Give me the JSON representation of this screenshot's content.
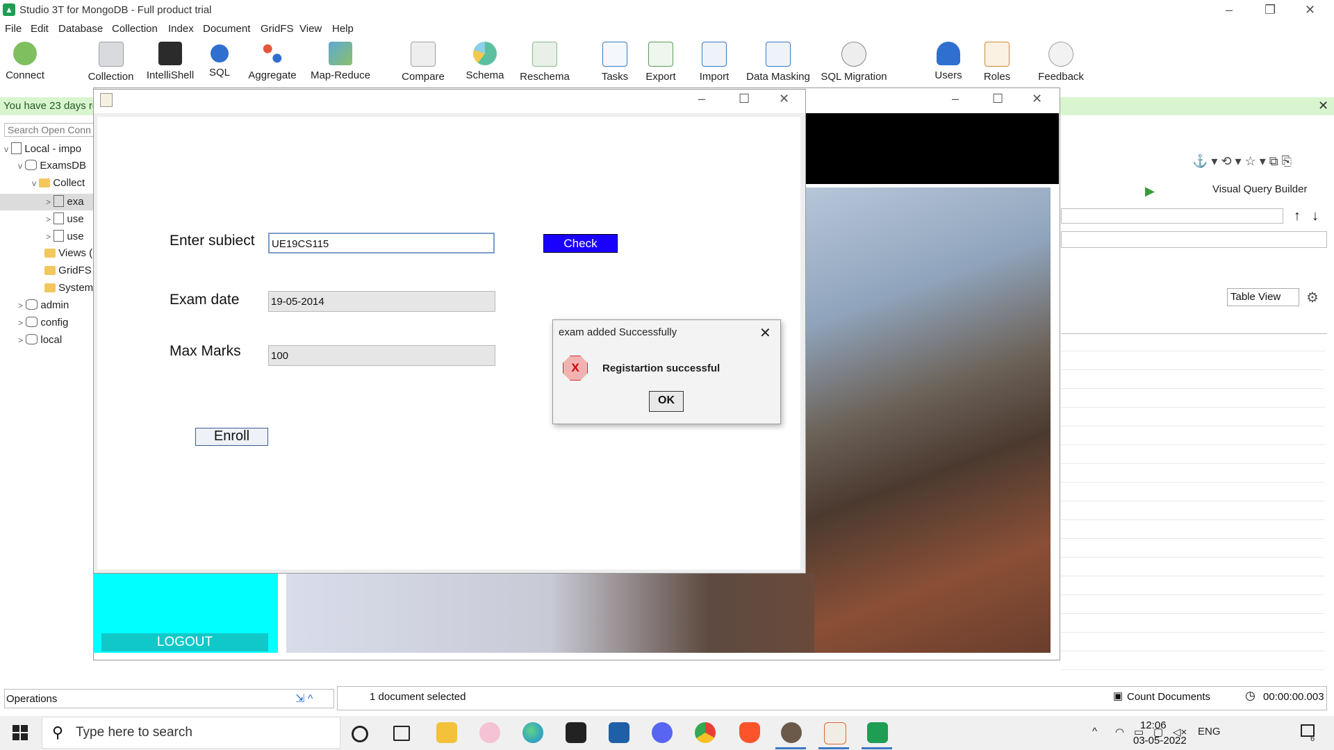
{
  "app": {
    "title": "Studio 3T for MongoDB - Full product trial",
    "minimize": "–",
    "restore": "❐",
    "close": "✕"
  },
  "menu": [
    "File",
    "Edit",
    "Database",
    "Collection",
    "Index",
    "Document",
    "GridFS",
    "View",
    "Help"
  ],
  "toolbar": [
    {
      "label": "Connect",
      "icon": "connect-icon",
      "color": "#7fbf5f"
    },
    {
      "label": "Collection",
      "icon": "collection-icon",
      "color": "#9aa0a6"
    },
    {
      "label": "IntelliShell",
      "icon": "intellishell-icon",
      "color": "#2b2b2b"
    },
    {
      "label": "SQL",
      "icon": "sql-icon",
      "color": "#2f6fd0"
    },
    {
      "label": "Aggregate",
      "icon": "aggregate-icon",
      "color": "#e4573d"
    },
    {
      "label": "Map-Reduce",
      "icon": "map-reduce-icon",
      "color": "#5fa8d3"
    },
    {
      "label": "Compare",
      "icon": "compare-icon",
      "color": "#a0a0a0"
    },
    {
      "label": "Schema",
      "icon": "schema-icon",
      "color": "#5cc0a0"
    },
    {
      "label": "Reschema",
      "icon": "reschema-icon",
      "color": "#8ab88a"
    },
    {
      "label": "Tasks",
      "icon": "tasks-icon",
      "color": "#3a78c2"
    },
    {
      "label": "Export",
      "icon": "export-icon",
      "color": "#5c9c5c"
    },
    {
      "label": "Import",
      "icon": "import-icon",
      "color": "#3a78c2"
    },
    {
      "label": "Data Masking",
      "icon": "data-masking-icon",
      "color": "#3a78c2"
    },
    {
      "label": "SQL Migration",
      "icon": "sql-migration-icon",
      "color": "#888888"
    },
    {
      "label": "Users",
      "icon": "users-icon",
      "color": "#2f6fd0"
    },
    {
      "label": "Roles",
      "icon": "roles-icon",
      "color": "#c98a3a"
    },
    {
      "label": "Feedback",
      "icon": "feedback-icon",
      "color": "#9aa0a6"
    }
  ],
  "trial_bar": {
    "text": "You have 23 days re",
    "close": "✕"
  },
  "sidebar": {
    "search_placeholder": "Search Open Conn",
    "tree": [
      {
        "label": "Local - impo",
        "caret": "v",
        "type": "conn"
      },
      {
        "label": "ExamsDB",
        "caret": "v",
        "type": "db"
      },
      {
        "label": "Collect",
        "caret": "v",
        "type": "folder"
      },
      {
        "label": "exa",
        "caret": ">",
        "type": "doc"
      },
      {
        "label": "use",
        "caret": ">",
        "type": "doc"
      },
      {
        "label": "use",
        "caret": ">",
        "type": "doc"
      },
      {
        "label": "Views (",
        "caret": "",
        "type": "folder"
      },
      {
        "label": "GridFS",
        "caret": "",
        "type": "folder"
      },
      {
        "label": "System",
        "caret": "",
        "type": "folder"
      },
      {
        "label": "admin",
        "caret": ">",
        "type": "db"
      },
      {
        "label": "config",
        "caret": ">",
        "type": "db"
      },
      {
        "label": "local",
        "caret": ">",
        "type": "db"
      }
    ]
  },
  "right_panel": {
    "visual_query_builder": "Visual Query Builder",
    "view_select": "Table View",
    "sort_up": "↑",
    "sort_down": "↓"
  },
  "java_app": {
    "subject_label": "Enter subiect",
    "subject_value": "UE19CS115",
    "check_label": "Check",
    "date_label": "Exam date",
    "date_value": "19-05-2014",
    "marks_label": "Max Marks",
    "marks_value": "100",
    "enroll_label": "Enroll",
    "logout_label": "LOGOUT"
  },
  "dialog": {
    "title": "exam added Successfully",
    "message": "Registartion successful",
    "ok_label": "OK",
    "error_glyph": "X",
    "close": "✕"
  },
  "status": {
    "operations": "Operations",
    "selection": "1 document selected",
    "count_documents": "Count Documents",
    "elapsed": "00:00:00.003"
  },
  "taskbar": {
    "search_placeholder": "Type here to search",
    "language": "ENG",
    "time": "12:06",
    "date": "03-05-2022",
    "notifications": "6",
    "apps": [
      {
        "icon": "cortana-icon",
        "color": "#222222"
      },
      {
        "icon": "task-view-icon",
        "color": "#222222"
      },
      {
        "icon": "file-explorer-icon",
        "color": "#f3c13a"
      },
      {
        "icon": "snipping-tool-icon",
        "color": "#e0457b"
      },
      {
        "icon": "edge-icon",
        "color": "#1b8ad6"
      },
      {
        "icon": "terminal-icon",
        "color": "#222222"
      },
      {
        "icon": "virtualbox-icon",
        "color": "#1f5fa8"
      },
      {
        "icon": "discord-icon",
        "color": "#5865f2"
      },
      {
        "icon": "chrome-icon",
        "color": "#e54035"
      },
      {
        "icon": "brave-icon",
        "color": "#fb542b"
      },
      {
        "icon": "game-icon",
        "color": "#6b5a4a"
      },
      {
        "icon": "java-icon",
        "color": "#d86b2a"
      },
      {
        "icon": "studio3t-icon",
        "color": "#1e9e52"
      }
    ]
  }
}
